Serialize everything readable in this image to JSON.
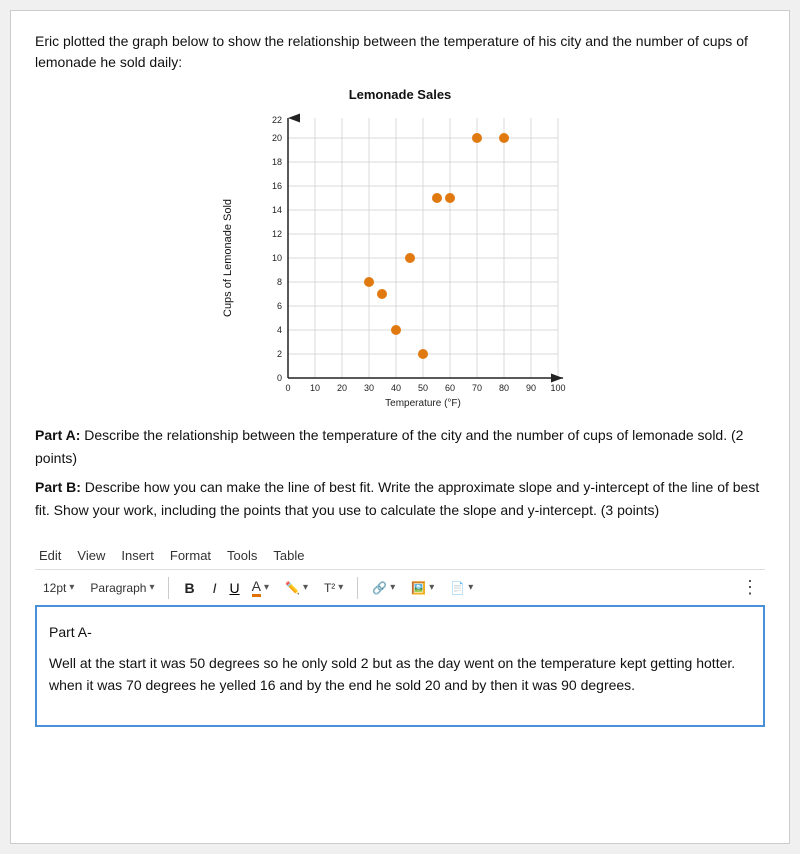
{
  "intro": {
    "text": "Eric plotted the graph below to show the relationship between the temperature of his city and the number of cups of lemonade he sold daily:"
  },
  "chart": {
    "title": "Lemonade Sales",
    "y_label": "Cups of Lemonade Sold",
    "x_label": "Temperature (°F)",
    "y_ticks": [
      0,
      2,
      4,
      6,
      8,
      10,
      12,
      14,
      16,
      18,
      20,
      22
    ],
    "x_ticks": [
      0,
      10,
      20,
      30,
      40,
      50,
      60,
      70,
      80,
      90,
      100
    ],
    "data_points": [
      {
        "x": 30,
        "y": 8
      },
      {
        "x": 35,
        "y": 7
      },
      {
        "x": 40,
        "y": 4
      },
      {
        "x": 45,
        "y": 10
      },
      {
        "x": 50,
        "y": 2
      },
      {
        "x": 55,
        "y": 15
      },
      {
        "x": 60,
        "y": 15
      },
      {
        "x": 70,
        "y": 20
      },
      {
        "x": 80,
        "y": 20
      }
    ]
  },
  "questions": {
    "part_a_label": "Part A:",
    "part_a_text": "Describe the relationship between the temperature of the city and the number of cups of lemonade sold. (2 points)",
    "part_b_label": "Part B:",
    "part_b_text": "Describe how you can make the line of best fit. Write the approximate slope and y-intercept of the line of best fit. Show your work, including the points that you use to calculate the slope and y-intercept. (3 points)"
  },
  "editor": {
    "menu": {
      "edit": "Edit",
      "view": "View",
      "insert": "Insert",
      "format": "Format",
      "tools": "Tools",
      "table": "Table"
    },
    "toolbar": {
      "font_size": "12pt",
      "paragraph": "Paragraph",
      "bold_label": "B",
      "italic_label": "I",
      "underline_label": "U",
      "color_label": "A",
      "superscript_label": "T²"
    },
    "content": {
      "part_a_header": "Part A-",
      "part_a_response": "Well at the start it was 50 degrees so he only sold 2 but as the day went on the temperature kept getting hotter. when it was 70 degrees he yelled 16 and by the end he sold 20 and by then it was 90 degrees."
    }
  }
}
